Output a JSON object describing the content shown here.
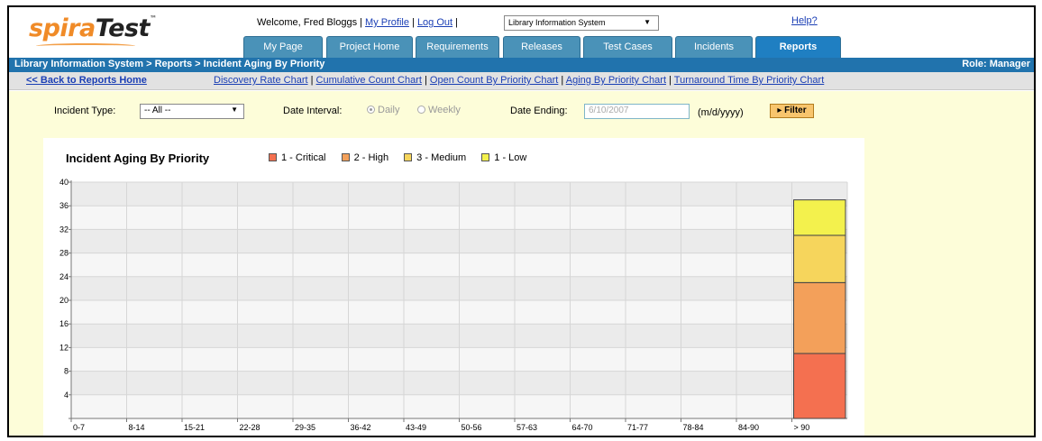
{
  "logo": {
    "part1": "spira",
    "part2": "Test",
    "tm": "™"
  },
  "header": {
    "welcome_text": "Welcome, Fred Bloggs  |",
    "my_profile": "My Profile",
    "sep1": "|",
    "log_out": "Log Out",
    "sep2": "|",
    "project_selected": "Library Information System",
    "help": "Help?"
  },
  "tabs": [
    {
      "label": "My Page"
    },
    {
      "label": "Project Home"
    },
    {
      "label": "Requirements"
    },
    {
      "label": "Releases"
    },
    {
      "label": "Test Cases"
    },
    {
      "label": "Incidents"
    },
    {
      "label": "Reports"
    }
  ],
  "breadcrumb": "Library Information System > Reports > Incident Aging By Priority",
  "role": "Role: Manager",
  "nav": {
    "back": "<< Back to Reports Home",
    "links": [
      "Discovery Rate Chart",
      "Cumulative Count Chart",
      "Open Count By Priority Chart",
      "Aging By Priority Chart",
      "Turnaround Time By Priority Chart"
    ],
    "separator": "|"
  },
  "filters": {
    "incident_type_label": "Incident Type:",
    "incident_type_value": "-- All --",
    "date_interval_label": "Date Interval:",
    "daily": "Daily",
    "weekly": "Weekly",
    "date_ending_label": "Date Ending:",
    "date_ending_value": "6/10/2007",
    "date_format": "(m/d/yyyy)",
    "filter_button": "Filter"
  },
  "chart_data": {
    "type": "bar",
    "stacked": true,
    "title": "Incident Aging By Priority",
    "categories": [
      "0-7",
      "8-14",
      "15-21",
      "22-28",
      "29-35",
      "36-42",
      "43-49",
      "50-56",
      "57-63",
      "64-70",
      "71-77",
      "78-84",
      "84-90",
      "> 90"
    ],
    "series": [
      {
        "name": "1 - Critical",
        "color": "#f47050",
        "values": [
          0,
          0,
          0,
          0,
          0,
          0,
          0,
          0,
          0,
          0,
          0,
          0,
          0,
          11
        ]
      },
      {
        "name": "2 - High",
        "color": "#f3a05a",
        "values": [
          0,
          0,
          0,
          0,
          0,
          0,
          0,
          0,
          0,
          0,
          0,
          0,
          0,
          12
        ]
      },
      {
        "name": "3 - Medium",
        "color": "#f6d55c",
        "values": [
          0,
          0,
          0,
          0,
          0,
          0,
          0,
          0,
          0,
          0,
          0,
          0,
          0,
          8
        ]
      },
      {
        "name": "1 - Low",
        "color": "#f3f14d",
        "values": [
          0,
          0,
          0,
          0,
          0,
          0,
          0,
          0,
          0,
          0,
          0,
          0,
          0,
          6
        ]
      }
    ],
    "y_ticks": [
      "4",
      "8",
      "12",
      "16",
      "20",
      "24",
      "28",
      "32",
      "36",
      "40"
    ],
    "ylim": [
      0,
      40
    ],
    "grid": true,
    "legend_position": "top"
  }
}
